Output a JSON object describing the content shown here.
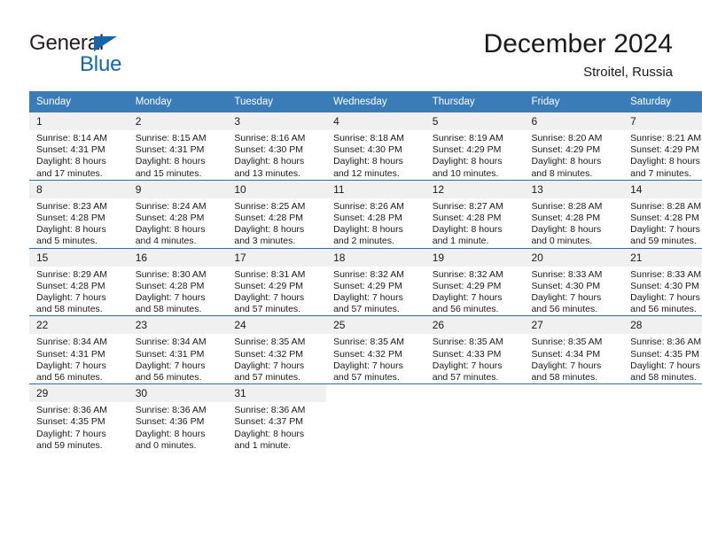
{
  "brand": {
    "name_part1": "General",
    "name_part2": "Blue",
    "triangle_color": "#1566ab"
  },
  "header": {
    "title": "December 2024",
    "subtitle": "Stroitel, Russia"
  },
  "theme": {
    "header_blue": "#3a7cb8",
    "row_divider": "#2f6ea5",
    "daynum_band": "#f0f0f0"
  },
  "weekday_headers": [
    "Sunday",
    "Monday",
    "Tuesday",
    "Wednesday",
    "Thursday",
    "Friday",
    "Saturday"
  ],
  "weeks": [
    [
      {
        "day": "1",
        "sunrise": "Sunrise: 8:14 AM",
        "sunset": "Sunset: 4:31 PM",
        "daylight1": "Daylight: 8 hours",
        "daylight2": "and 17 minutes."
      },
      {
        "day": "2",
        "sunrise": "Sunrise: 8:15 AM",
        "sunset": "Sunset: 4:31 PM",
        "daylight1": "Daylight: 8 hours",
        "daylight2": "and 15 minutes."
      },
      {
        "day": "3",
        "sunrise": "Sunrise: 8:16 AM",
        "sunset": "Sunset: 4:30 PM",
        "daylight1": "Daylight: 8 hours",
        "daylight2": "and 13 minutes."
      },
      {
        "day": "4",
        "sunrise": "Sunrise: 8:18 AM",
        "sunset": "Sunset: 4:30 PM",
        "daylight1": "Daylight: 8 hours",
        "daylight2": "and 12 minutes."
      },
      {
        "day": "5",
        "sunrise": "Sunrise: 8:19 AM",
        "sunset": "Sunset: 4:29 PM",
        "daylight1": "Daylight: 8 hours",
        "daylight2": "and 10 minutes."
      },
      {
        "day": "6",
        "sunrise": "Sunrise: 8:20 AM",
        "sunset": "Sunset: 4:29 PM",
        "daylight1": "Daylight: 8 hours",
        "daylight2": "and 8 minutes."
      },
      {
        "day": "7",
        "sunrise": "Sunrise: 8:21 AM",
        "sunset": "Sunset: 4:29 PM",
        "daylight1": "Daylight: 8 hours",
        "daylight2": "and 7 minutes."
      }
    ],
    [
      {
        "day": "8",
        "sunrise": "Sunrise: 8:23 AM",
        "sunset": "Sunset: 4:28 PM",
        "daylight1": "Daylight: 8 hours",
        "daylight2": "and 5 minutes."
      },
      {
        "day": "9",
        "sunrise": "Sunrise: 8:24 AM",
        "sunset": "Sunset: 4:28 PM",
        "daylight1": "Daylight: 8 hours",
        "daylight2": "and 4 minutes."
      },
      {
        "day": "10",
        "sunrise": "Sunrise: 8:25 AM",
        "sunset": "Sunset: 4:28 PM",
        "daylight1": "Daylight: 8 hours",
        "daylight2": "and 3 minutes."
      },
      {
        "day": "11",
        "sunrise": "Sunrise: 8:26 AM",
        "sunset": "Sunset: 4:28 PM",
        "daylight1": "Daylight: 8 hours",
        "daylight2": "and 2 minutes."
      },
      {
        "day": "12",
        "sunrise": "Sunrise: 8:27 AM",
        "sunset": "Sunset: 4:28 PM",
        "daylight1": "Daylight: 8 hours",
        "daylight2": "and 1 minute."
      },
      {
        "day": "13",
        "sunrise": "Sunrise: 8:28 AM",
        "sunset": "Sunset: 4:28 PM",
        "daylight1": "Daylight: 8 hours",
        "daylight2": "and 0 minutes."
      },
      {
        "day": "14",
        "sunrise": "Sunrise: 8:28 AM",
        "sunset": "Sunset: 4:28 PM",
        "daylight1": "Daylight: 7 hours",
        "daylight2": "and 59 minutes."
      }
    ],
    [
      {
        "day": "15",
        "sunrise": "Sunrise: 8:29 AM",
        "sunset": "Sunset: 4:28 PM",
        "daylight1": "Daylight: 7 hours",
        "daylight2": "and 58 minutes."
      },
      {
        "day": "16",
        "sunrise": "Sunrise: 8:30 AM",
        "sunset": "Sunset: 4:28 PM",
        "daylight1": "Daylight: 7 hours",
        "daylight2": "and 58 minutes."
      },
      {
        "day": "17",
        "sunrise": "Sunrise: 8:31 AM",
        "sunset": "Sunset: 4:29 PM",
        "daylight1": "Daylight: 7 hours",
        "daylight2": "and 57 minutes."
      },
      {
        "day": "18",
        "sunrise": "Sunrise: 8:32 AM",
        "sunset": "Sunset: 4:29 PM",
        "daylight1": "Daylight: 7 hours",
        "daylight2": "and 57 minutes."
      },
      {
        "day": "19",
        "sunrise": "Sunrise: 8:32 AM",
        "sunset": "Sunset: 4:29 PM",
        "daylight1": "Daylight: 7 hours",
        "daylight2": "and 56 minutes."
      },
      {
        "day": "20",
        "sunrise": "Sunrise: 8:33 AM",
        "sunset": "Sunset: 4:30 PM",
        "daylight1": "Daylight: 7 hours",
        "daylight2": "and 56 minutes."
      },
      {
        "day": "21",
        "sunrise": "Sunrise: 8:33 AM",
        "sunset": "Sunset: 4:30 PM",
        "daylight1": "Daylight: 7 hours",
        "daylight2": "and 56 minutes."
      }
    ],
    [
      {
        "day": "22",
        "sunrise": "Sunrise: 8:34 AM",
        "sunset": "Sunset: 4:31 PM",
        "daylight1": "Daylight: 7 hours",
        "daylight2": "and 56 minutes."
      },
      {
        "day": "23",
        "sunrise": "Sunrise: 8:34 AM",
        "sunset": "Sunset: 4:31 PM",
        "daylight1": "Daylight: 7 hours",
        "daylight2": "and 56 minutes."
      },
      {
        "day": "24",
        "sunrise": "Sunrise: 8:35 AM",
        "sunset": "Sunset: 4:32 PM",
        "daylight1": "Daylight: 7 hours",
        "daylight2": "and 57 minutes."
      },
      {
        "day": "25",
        "sunrise": "Sunrise: 8:35 AM",
        "sunset": "Sunset: 4:32 PM",
        "daylight1": "Daylight: 7 hours",
        "daylight2": "and 57 minutes."
      },
      {
        "day": "26",
        "sunrise": "Sunrise: 8:35 AM",
        "sunset": "Sunset: 4:33 PM",
        "daylight1": "Daylight: 7 hours",
        "daylight2": "and 57 minutes."
      },
      {
        "day": "27",
        "sunrise": "Sunrise: 8:35 AM",
        "sunset": "Sunset: 4:34 PM",
        "daylight1": "Daylight: 7 hours",
        "daylight2": "and 58 minutes."
      },
      {
        "day": "28",
        "sunrise": "Sunrise: 8:36 AM",
        "sunset": "Sunset: 4:35 PM",
        "daylight1": "Daylight: 7 hours",
        "daylight2": "and 58 minutes."
      }
    ],
    [
      {
        "day": "29",
        "sunrise": "Sunrise: 8:36 AM",
        "sunset": "Sunset: 4:35 PM",
        "daylight1": "Daylight: 7 hours",
        "daylight2": "and 59 minutes."
      },
      {
        "day": "30",
        "sunrise": "Sunrise: 8:36 AM",
        "sunset": "Sunset: 4:36 PM",
        "daylight1": "Daylight: 8 hours",
        "daylight2": "and 0 minutes."
      },
      {
        "day": "31",
        "sunrise": "Sunrise: 8:36 AM",
        "sunset": "Sunset: 4:37 PM",
        "daylight1": "Daylight: 8 hours",
        "daylight2": "and 1 minute."
      },
      {
        "day": "",
        "sunrise": "",
        "sunset": "",
        "daylight1": "",
        "daylight2": ""
      },
      {
        "day": "",
        "sunrise": "",
        "sunset": "",
        "daylight1": "",
        "daylight2": ""
      },
      {
        "day": "",
        "sunrise": "",
        "sunset": "",
        "daylight1": "",
        "daylight2": ""
      },
      {
        "day": "",
        "sunrise": "",
        "sunset": "",
        "daylight1": "",
        "daylight2": ""
      }
    ]
  ]
}
